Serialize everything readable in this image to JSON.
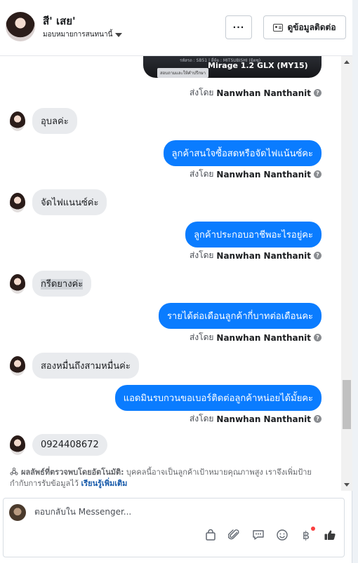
{
  "header": {
    "contact_name": "สี' เสย'",
    "assign_label": "มอบหมายการสนทนานี้",
    "more_label": "···",
    "contact_info_label": "ดูข้อมูลติดต่อ"
  },
  "attachment": {
    "meta": "รหัสรถ : SB51 | ยี่ห้อ : MITSUBISHI (มิตซู)",
    "model": "Mirage 1.2 GLX (MY15)",
    "caption": "สอบถามและให้คำปรึกษา"
  },
  "sent_by_prefix": "ส่งโดย",
  "agent_name": "Nanwhan Nanthanit",
  "messages": [
    {
      "dir": "in",
      "text": "อุบลค่ะ"
    },
    {
      "dir": "out",
      "text": "ลูกค้าสนใจซื้อสดหรือจัดไฟแน้นซ์คะ"
    },
    {
      "dir": "in",
      "text": "จัดไฟแนนซ์ค่ะ"
    },
    {
      "dir": "out",
      "text": "ลูกค้าประกอบอาชีพอะไรอยู่คะ"
    },
    {
      "dir": "in",
      "text": "กรีดยางค่ะ"
    },
    {
      "dir": "out",
      "text": "รายได้ต่อเดือนลูกค้ากี่บาทต่อเดือนคะ"
    },
    {
      "dir": "in",
      "text": "สองหมื่นถึงสามหมื่นค่ะ"
    },
    {
      "dir": "out",
      "text": "แอดมินรบกวนขอเบอร์ติดต่อลูกค้าหน่อยได้มั้ยคะ"
    },
    {
      "dir": "in",
      "text": "0924408672"
    }
  ],
  "auto_note": {
    "label": "ผลลัพธ์ที่ตรวจพบโดยอัตโนมัติ:",
    "body": "บุคคลนี้อาจเป็นลูกค้าเป้าหมายคุณภาพสูง เราจึงเพิ่มป้ายกำกับการรับข้อมูลไว้",
    "link": "เรียนรู้เพิ่มเติม"
  },
  "composer": {
    "placeholder": "ตอบกลับใน Messenger..."
  },
  "icons": [
    "chevron-down-icon",
    "contact-card-icon",
    "shopping-bag-icon",
    "paperclip-icon",
    "saved-reply-icon",
    "emoji-icon",
    "baht-icon",
    "thumbs-up-icon",
    "auto-detect-icon"
  ],
  "colors": {
    "accent": "#0a7cff",
    "incoming_bubble": "#e9ebee",
    "link": "#1a5cab",
    "notification": "#fa3e3e"
  }
}
